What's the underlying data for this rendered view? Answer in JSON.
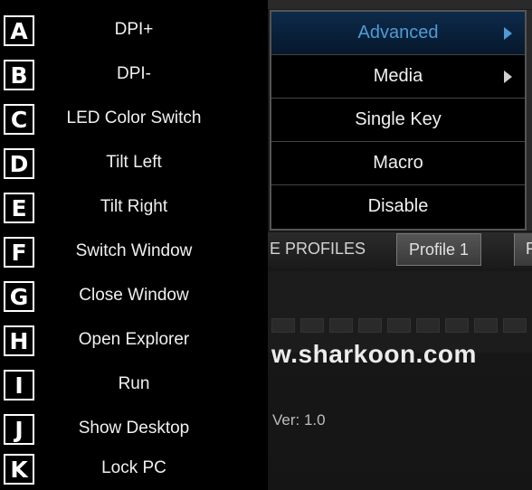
{
  "left_menu": {
    "items": [
      {
        "badge": "A",
        "label": "DPI+"
      },
      {
        "badge": "B",
        "label": "DPI-"
      },
      {
        "badge": "C",
        "label": "LED Color Switch"
      },
      {
        "badge": "D",
        "label": "Tilt Left"
      },
      {
        "badge": "E",
        "label": "Tilt Right"
      },
      {
        "badge": "F",
        "label": "Switch Window"
      },
      {
        "badge": "G",
        "label": "Close Window"
      },
      {
        "badge": "H",
        "label": "Open Explorer"
      },
      {
        "badge": "I",
        "label": "Run"
      },
      {
        "badge": "J",
        "label": "Show Desktop"
      },
      {
        "badge": "K",
        "label": "Lock PC"
      }
    ]
  },
  "submenu": {
    "items": [
      {
        "label": "Advanced",
        "has_arrow": true,
        "active": true
      },
      {
        "label": "Media",
        "has_arrow": true,
        "active": false
      },
      {
        "label": "Single Key",
        "has_arrow": false,
        "active": false
      },
      {
        "label": "Macro",
        "has_arrow": false,
        "active": false
      },
      {
        "label": "Disable",
        "has_arrow": false,
        "active": false
      }
    ]
  },
  "app": {
    "profiles_label": "E PROFILES",
    "active_profile": "Profile 1",
    "next_profile_fragment": "P",
    "website": "w.sharkoon.com",
    "version": "Ver: 1.0"
  },
  "colors": {
    "menu_bg": "#000000",
    "active_item_text": "#4f9bd6",
    "active_item_bg": "#0d2a4a",
    "text": "#f0f0f0"
  }
}
